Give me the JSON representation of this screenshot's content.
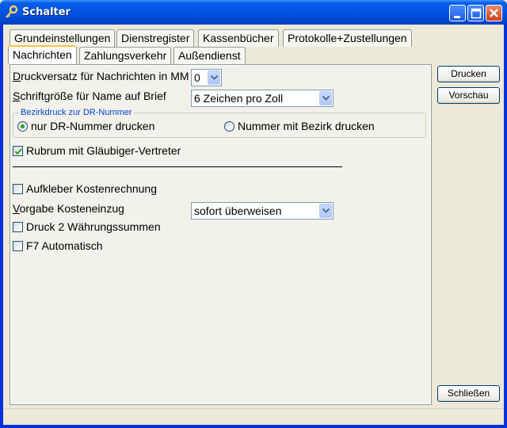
{
  "window": {
    "title": "Schalter",
    "title_bar_color": "#0054e3"
  },
  "tabs": {
    "row1": [
      {
        "label": "Grundeinstellungen"
      },
      {
        "label": "Dienstregister"
      },
      {
        "label": "Kassenbücher"
      },
      {
        "label": "Protokolle+Zustellungen"
      }
    ],
    "row2": [
      {
        "label": "Nachrichten",
        "active": true
      },
      {
        "label": "Zahlungsverkehr"
      },
      {
        "label": "Außendienst"
      }
    ]
  },
  "form": {
    "druckversatz": {
      "label_first": "D",
      "label_rest": "ruckversatz für Nachrichten in MM",
      "value": "0"
    },
    "schriftgroesse": {
      "label_first": "S",
      "label_rest": "chriftgröße für Name auf Brief",
      "value": "6 Zeichen pro Zoll"
    },
    "bezirkdruck": {
      "title": "Bezirkdruck zur DR-Nummer",
      "option1": "nur DR-Nummer drucken",
      "option2": "Nummer mit Bezirk drucken",
      "selected": "option1"
    },
    "rubrum": {
      "label": "Rubrum mit Gläubiger-Vertreter",
      "checked": true
    },
    "aufkleber": {
      "label": "Aufkleber Kostenrechnung",
      "checked": false
    },
    "vorgabe": {
      "label_first": "V",
      "label_rest": "orgabe Kosteneinzug",
      "value": "sofort überweisen"
    },
    "waehrung": {
      "label": "Druck 2 Währungssummen",
      "checked": false
    },
    "f7": {
      "label": "F7 Automatisch",
      "checked": false
    }
  },
  "buttons": {
    "drucken": "Drucken",
    "vorschau": "Vorschau",
    "schliessen": "Schließen"
  },
  "icons": {
    "app": "key-icon",
    "minimize": "minimize-icon",
    "maximize": "maximize-icon",
    "close": "close-icon"
  }
}
